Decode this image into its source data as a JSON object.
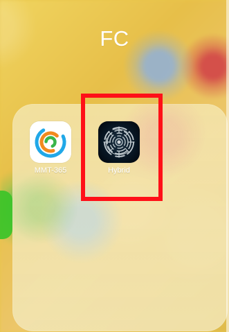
{
  "folder": {
    "title": "FC"
  },
  "apps": [
    {
      "label": "MMT-365",
      "icon": "circular-progress-app-icon"
    },
    {
      "label": "Hybrid",
      "icon": "maze-orb-app-icon"
    }
  ],
  "highlight": {
    "color": "#ff1018",
    "target": "Hybrid"
  },
  "colors": {
    "wallpaper": "#e8c64a",
    "folder_panel": "#f2e6b6",
    "label_text": "#ffffff",
    "mmt_blue": "#21a8e8",
    "mmt_orange": "#f28a1e",
    "mmt_green": "#39b54a",
    "hybrid_background": "#061321"
  }
}
